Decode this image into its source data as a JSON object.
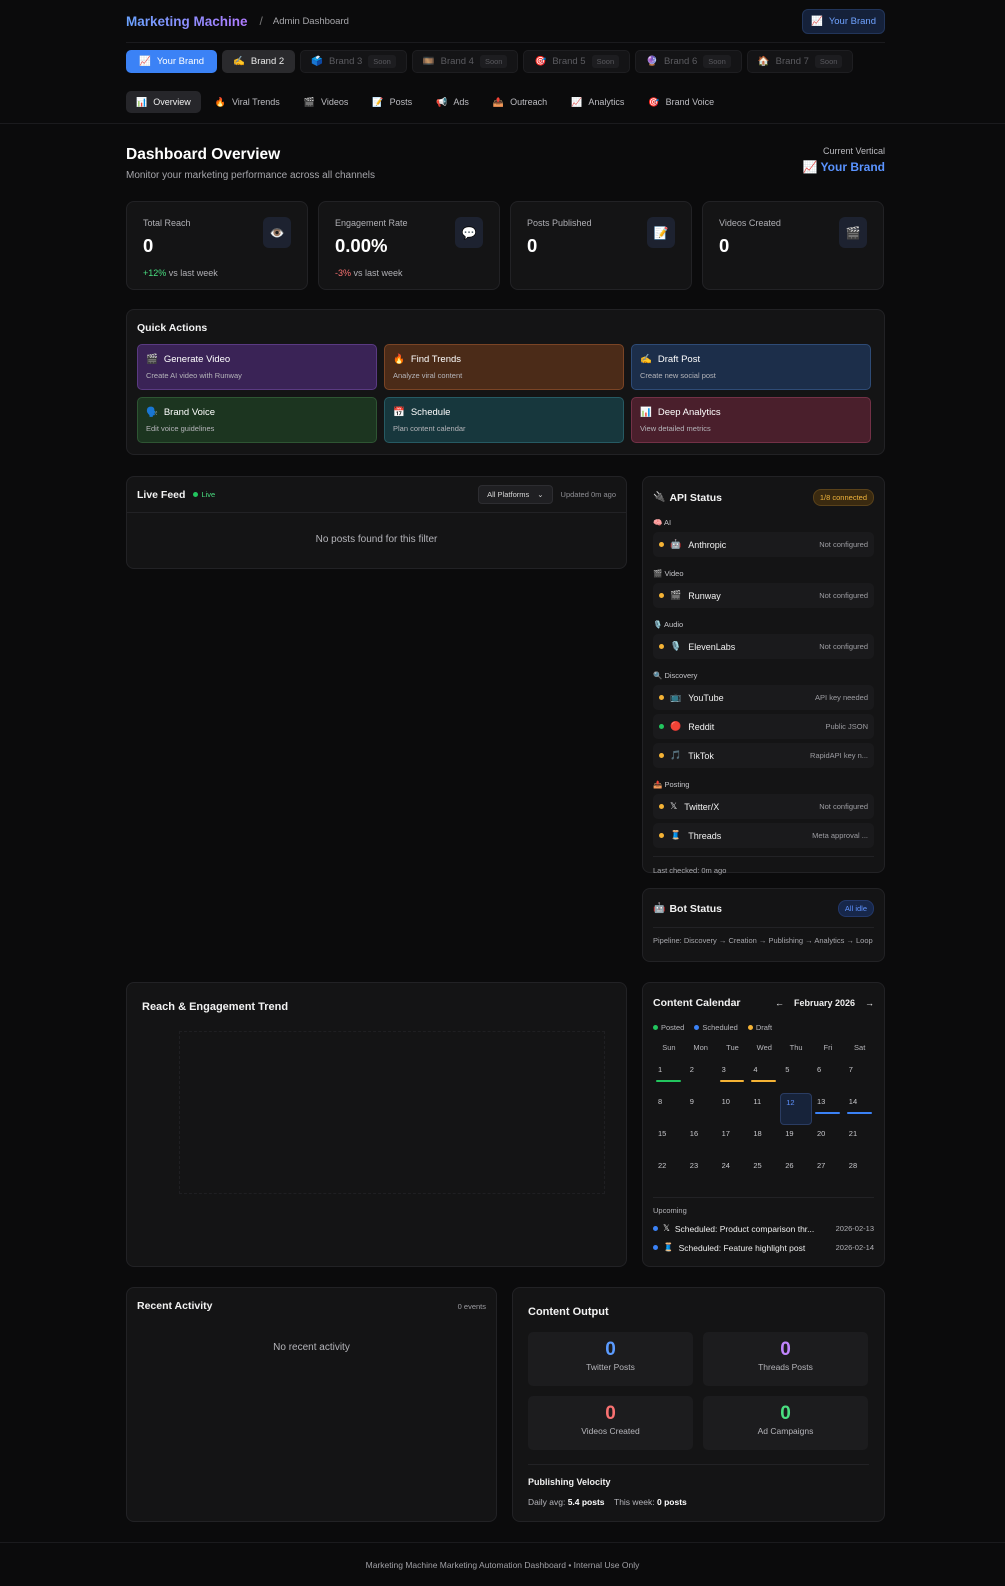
{
  "header": {
    "logo": "Marketing Machine",
    "separator": "/",
    "crumb": "Admin Dashboard",
    "brand_button": "Your Brand",
    "brand_button_icon": "📈"
  },
  "brand_tabs": [
    {
      "icon": "📈",
      "label": "Your Brand",
      "soon": ""
    },
    {
      "icon": "✍️",
      "label": "Brand 2",
      "soon": ""
    },
    {
      "icon": "🗳️",
      "label": "Brand 3",
      "soon": "Soon"
    },
    {
      "icon": "🎞️",
      "label": "Brand 4",
      "soon": "Soon"
    },
    {
      "icon": "🎯",
      "label": "Brand 5",
      "soon": "Soon"
    },
    {
      "icon": "🔮",
      "label": "Brand 6",
      "soon": "Soon"
    },
    {
      "icon": "🏠",
      "label": "Brand 7",
      "soon": "Soon"
    }
  ],
  "nav_tabs": [
    {
      "icon": "📊",
      "label": "Overview"
    },
    {
      "icon": "🔥",
      "label": "Viral Trends"
    },
    {
      "icon": "🎬",
      "label": "Videos"
    },
    {
      "icon": "📝",
      "label": "Posts"
    },
    {
      "icon": "📢",
      "label": "Ads"
    },
    {
      "icon": "📤",
      "label": "Outreach"
    },
    {
      "icon": "📈",
      "label": "Analytics"
    },
    {
      "icon": "🎯",
      "label": "Brand Voice"
    }
  ],
  "overview": {
    "title": "Dashboard Overview",
    "subtitle": "Monitor your marketing performance across all channels",
    "vertical_label": "Current Vertical",
    "vertical_icon": "📈",
    "vertical_value": "Your Brand"
  },
  "stats": [
    {
      "title": "Total Reach",
      "value": "0",
      "delta": "+12%",
      "delta_rest": " vs last week",
      "icon": "👁️"
    },
    {
      "title": "Engagement Rate",
      "value": "0.00%",
      "delta": "-3%",
      "delta_rest": " vs last week",
      "icon": "💬"
    },
    {
      "title": "Posts Published",
      "value": "0",
      "delta": "",
      "delta_rest": "",
      "icon": "📝"
    },
    {
      "title": "Videos Created",
      "value": "0",
      "delta": "",
      "delta_rest": "",
      "icon": "🎬"
    }
  ],
  "quick_actions": {
    "title": "Quick Actions",
    "items": [
      {
        "icon": "🎬",
        "label": "Generate Video",
        "desc": "Create AI video with Runway"
      },
      {
        "icon": "🔥",
        "label": "Find Trends",
        "desc": "Analyze viral content"
      },
      {
        "icon": "✍️",
        "label": "Draft Post",
        "desc": "Create new social post"
      },
      {
        "icon": "🗣️",
        "label": "Brand Voice",
        "desc": "Edit voice guidelines"
      },
      {
        "icon": "📅",
        "label": "Schedule",
        "desc": "Plan content calendar"
      },
      {
        "icon": "📊",
        "label": "Deep Analytics",
        "desc": "View detailed metrics"
      }
    ]
  },
  "feed": {
    "title": "Live Feed",
    "live": "Live",
    "filter": "All Platforms",
    "updated": "Updated 0m ago",
    "empty": "No posts found for this filter"
  },
  "api": {
    "title": "API Status",
    "title_icon": "🔌",
    "badge": "1/8 connected",
    "groups": [
      {
        "label": "AI",
        "icon": "🧠",
        "rows": [
          {
            "name": "Anthropic",
            "icon": "🤖",
            "status": "Not configured",
            "dot": "#f5b335"
          }
        ]
      },
      {
        "label": "Video",
        "icon": "🎬",
        "rows": [
          {
            "name": "Runway",
            "icon": "🎬",
            "status": "Not configured",
            "dot": "#f5b335"
          }
        ]
      },
      {
        "label": "Audio",
        "icon": "🎙️",
        "rows": [
          {
            "name": "ElevenLabs",
            "icon": "🎙️",
            "status": "Not configured",
            "dot": "#f5b335"
          }
        ]
      },
      {
        "label": "Discovery",
        "icon": "🔍",
        "rows": [
          {
            "name": "YouTube",
            "icon": "📺",
            "status": "API key needed",
            "dot": "#f5b335"
          },
          {
            "name": "Reddit",
            "icon": "🔴",
            "status": "Public JSON",
            "dot": "#22c55e"
          },
          {
            "name": "TikTok",
            "icon": "🎵",
            "status": "RapidAPI key n...",
            "dot": "#f5b335"
          }
        ]
      },
      {
        "label": "Posting",
        "icon": "📤",
        "rows": [
          {
            "name": "Twitter/X",
            "icon": "𝕏",
            "status": "Not configured",
            "dot": "#f5b335"
          },
          {
            "name": "Threads",
            "icon": "🧵",
            "status": "Meta approval ...",
            "dot": "#f5b335"
          }
        ]
      }
    ],
    "last_checked": "Last checked: 0m ago"
  },
  "bot": {
    "title": "Bot Status",
    "icon": "🤖",
    "badge": "All idle",
    "pipeline": "Pipeline: Discovery → Creation → Publishing → Analytics → Loop"
  },
  "trend": {
    "title": "Reach & Engagement Trend"
  },
  "calendar": {
    "title": "Content Calendar",
    "month": "February 2026",
    "prev": "←",
    "next": "→",
    "legend": [
      {
        "label": "Posted",
        "color": "#22c55e"
      },
      {
        "label": "Scheduled",
        "color": "#3b82f6"
      },
      {
        "label": "Draft",
        "color": "#f5b335"
      }
    ],
    "dow": [
      "Sun",
      "Mon",
      "Tue",
      "Wed",
      "Thu",
      "Fri",
      "Sat"
    ],
    "days": [
      {
        "d": "1",
        "bar": "#22c55e"
      },
      {
        "d": "2"
      },
      {
        "d": "3",
        "bar": "#f5b335"
      },
      {
        "d": "4",
        "bar": "#f5b335"
      },
      {
        "d": "5"
      },
      {
        "d": "6"
      },
      {
        "d": "7"
      },
      {
        "d": "8"
      },
      {
        "d": "9"
      },
      {
        "d": "10"
      },
      {
        "d": "11"
      },
      {
        "d": "12",
        "today": true
      },
      {
        "d": "13",
        "bar": "#3b82f6"
      },
      {
        "d": "14",
        "bar": "#3b82f6"
      },
      {
        "d": "15"
      },
      {
        "d": "16"
      },
      {
        "d": "17"
      },
      {
        "d": "18"
      },
      {
        "d": "19"
      },
      {
        "d": "20"
      },
      {
        "d": "21"
      },
      {
        "d": "22"
      },
      {
        "d": "23"
      },
      {
        "d": "24"
      },
      {
        "d": "25"
      },
      {
        "d": "26"
      },
      {
        "d": "27"
      },
      {
        "d": "28"
      }
    ],
    "upcoming_label": "Upcoming",
    "upcoming": [
      {
        "icon": "𝕏",
        "text": "Scheduled: Product comparison thr...",
        "date": "2026-02-13"
      },
      {
        "icon": "🧵",
        "text": "Scheduled: Feature highlight post",
        "date": "2026-02-14"
      }
    ]
  },
  "activity": {
    "title": "Recent Activity",
    "events": "0 events",
    "empty": "No recent activity"
  },
  "output": {
    "title": "Content Output",
    "items": [
      {
        "value": "0",
        "label": "Twitter Posts",
        "color": "#5b9bff"
      },
      {
        "value": "0",
        "label": "Threads Posts",
        "color": "#c084fc"
      },
      {
        "value": "0",
        "label": "Videos Created",
        "color": "#f87171"
      },
      {
        "value": "0",
        "label": "Ad Campaigns",
        "color": "#4ade80"
      }
    ],
    "velocity_title": "Publishing Velocity",
    "daily_label": "Daily avg: ",
    "daily_value": "5.4 posts",
    "week_label": "This week: ",
    "week_value": "0 posts"
  },
  "footer": "Marketing Machine Marketing Automation Dashboard • Internal Use Only"
}
